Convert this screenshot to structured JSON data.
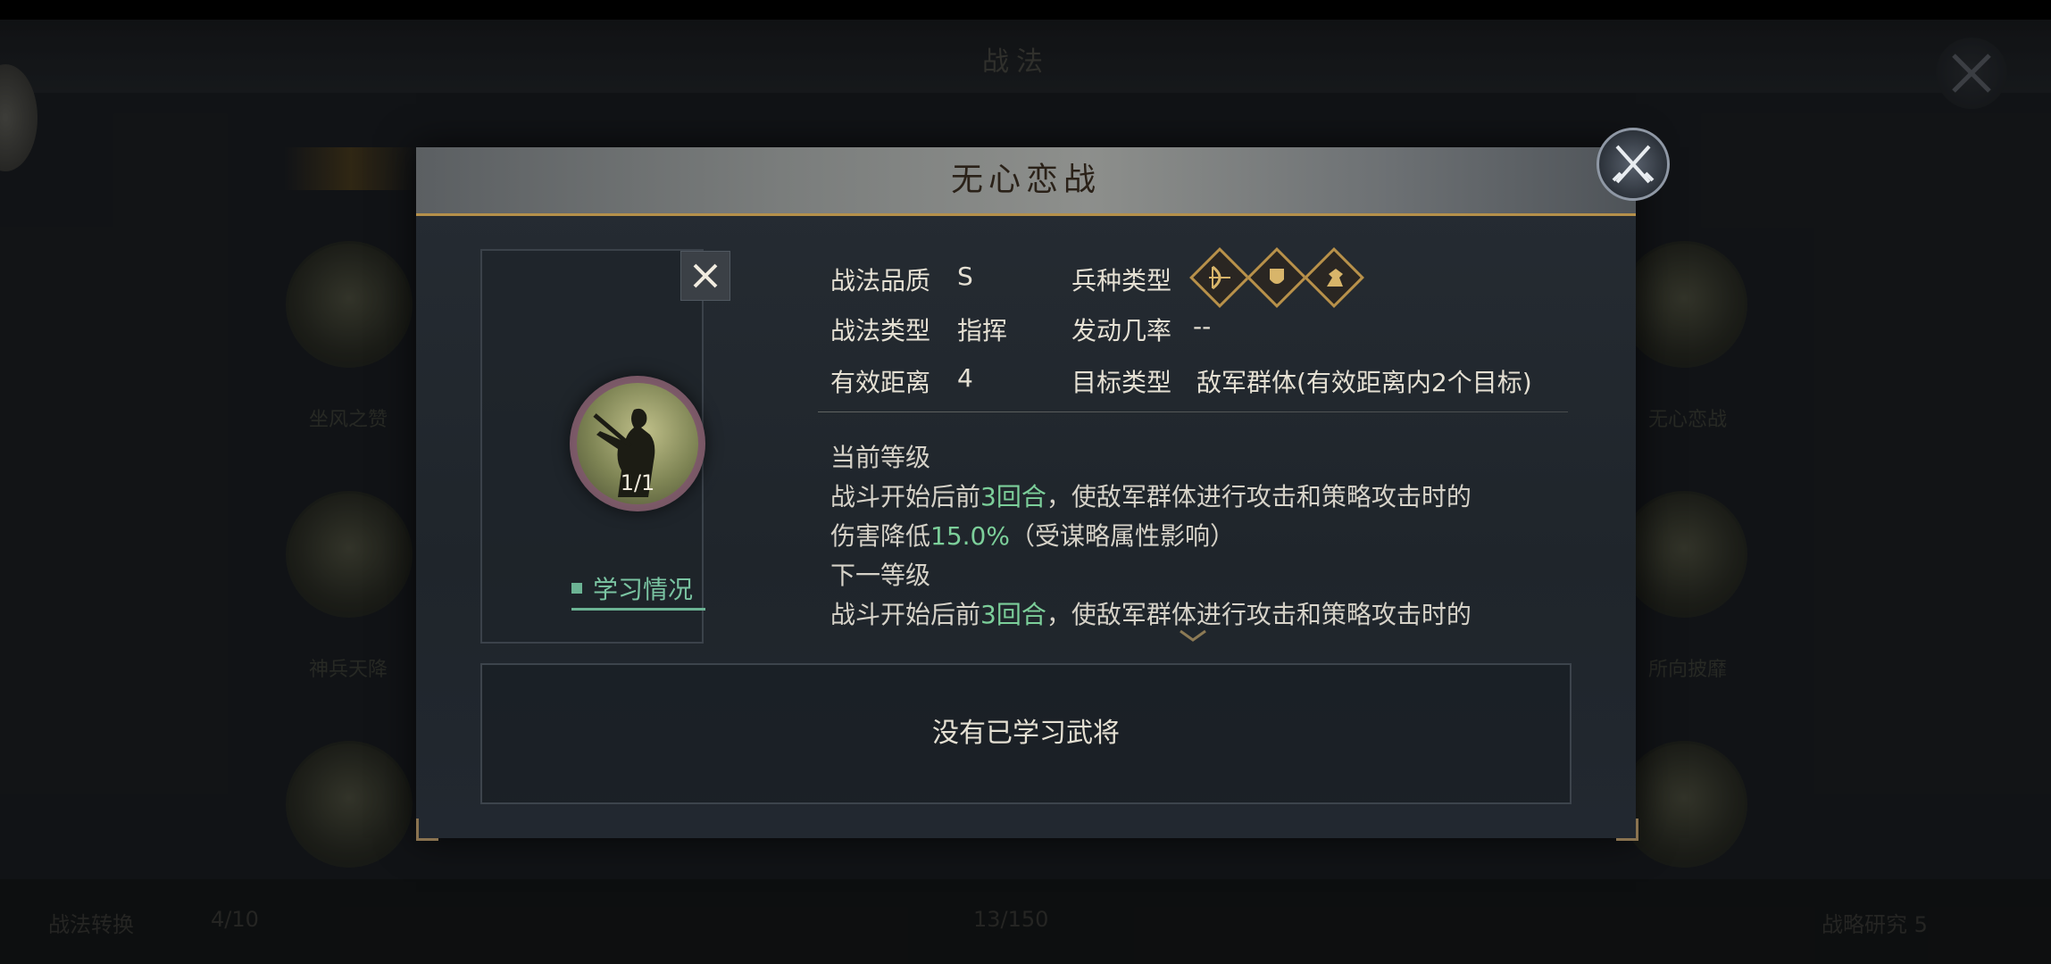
{
  "background": {
    "title": "战法",
    "labels": [
      "坐风之赞",
      "神兵天降",
      "无心恋战",
      "所向披靡"
    ],
    "footer_left": "战法转换",
    "footer_left_count": "4/10",
    "footer_center": "13/150",
    "footer_right": "战略研究 5"
  },
  "dialog": {
    "title": "无心恋战",
    "stats": {
      "quality_label": "战法品质",
      "quality_value": "S",
      "type_label": "战法类型",
      "type_value": "指挥",
      "range_label": "有效距离",
      "range_value": "4",
      "troop_label": "兵种类型",
      "troop_icons": [
        "archer-icon",
        "shield-icon",
        "cavalry-icon"
      ],
      "rate_label": "发动几率",
      "rate_value": "--",
      "target_label": "目标类型",
      "target_value": "敌军群体(有效距离内2个目标)"
    },
    "skill": {
      "count": "1/1",
      "learn_label": "学习情况"
    },
    "current": {
      "heading": "当前等级",
      "line1_pre": "战斗开始后前",
      "line1_hl": "3回合",
      "line1_post": "，使敌军群体进行攻击和策略攻击时的",
      "line2_pre": "伤害降低",
      "line2_hl": "15.0%",
      "line2_post": "（受谋略属性影响）"
    },
    "next": {
      "heading": "下一等级",
      "line1_pre": "战斗开始后前",
      "line1_hl": "3回合",
      "line1_post": "，使敌军群体进行攻击和策略攻击时的"
    },
    "generals_empty": "没有已学习武将"
  },
  "colors": {
    "accent_green": "#7ccf9a",
    "gold": "#b8914a"
  }
}
